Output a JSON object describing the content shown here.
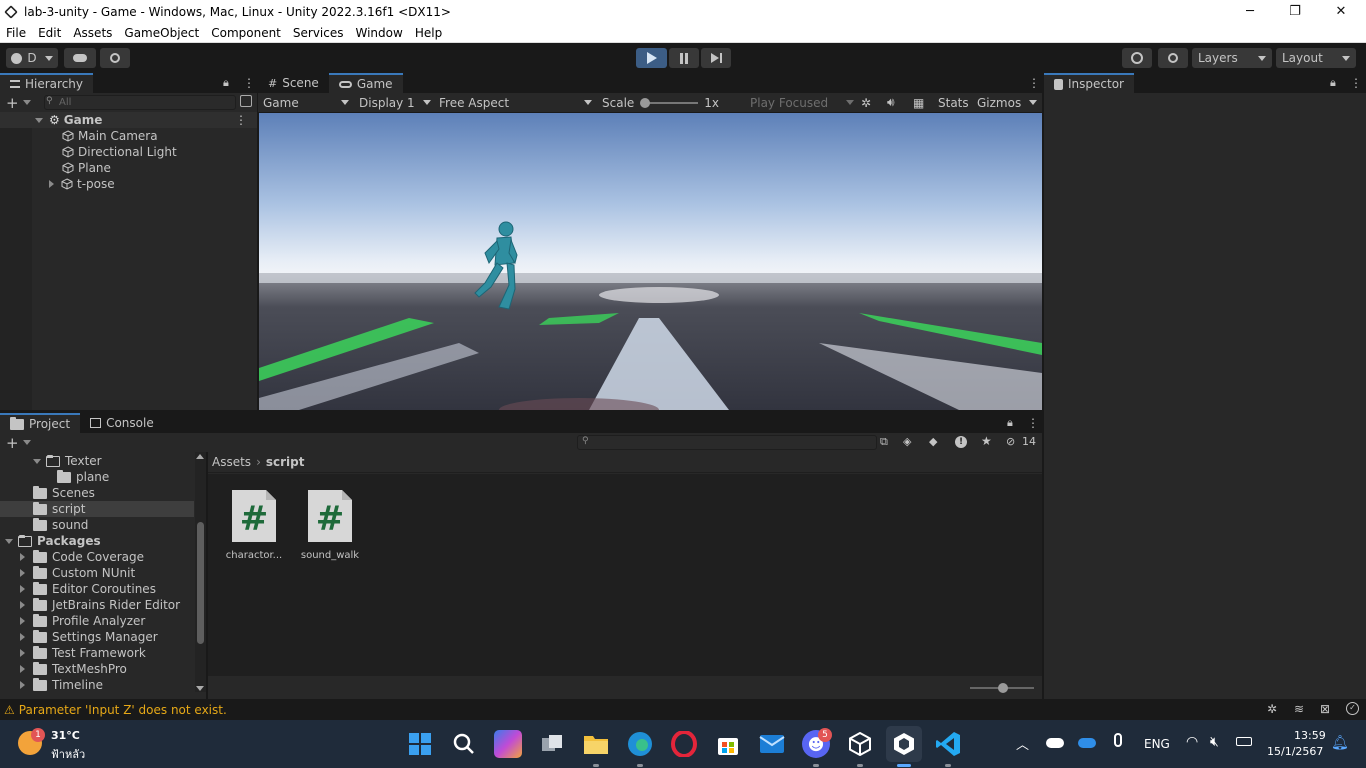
{
  "window": {
    "title": "lab-3-unity - Game - Windows, Mac, Linux - Unity 2022.3.16f1 <DX11>",
    "controls": {
      "minimize": "─",
      "maximize": "❐",
      "close": "✕"
    }
  },
  "menu": [
    "File",
    "Edit",
    "Assets",
    "GameObject",
    "Component",
    "Services",
    "Window",
    "Help"
  ],
  "toolbar": {
    "account_label": "D",
    "layers_label": "Layers",
    "layout_label": "Layout"
  },
  "hierarchy": {
    "tab_label": "Hierarchy",
    "search_placeholder": "All",
    "scene_name": "Game",
    "objects": [
      "Main Camera",
      "Directional Light",
      "Plane",
      "t-pose"
    ]
  },
  "game_view": {
    "tabs": [
      "Scene",
      "Game"
    ],
    "view_mode": "Game",
    "display": "Display 1",
    "aspect": "Free Aspect",
    "scale_label": "Scale",
    "scale_value": "1x",
    "play_mode": "Play Focused",
    "stats_label": "Stats",
    "gizmos_label": "Gizmos"
  },
  "inspector": {
    "tab_label": "Inspector"
  },
  "project": {
    "tabs": [
      "Project",
      "Console"
    ],
    "hidden_count": "14",
    "breadcrumb": [
      "Assets",
      "script"
    ],
    "tree": {
      "texter": "Texter",
      "plane": "plane",
      "scenes": "Scenes",
      "script": "script",
      "sound": "sound",
      "packages": "Packages",
      "package_items": [
        "Code Coverage",
        "Custom NUnit",
        "Editor Coroutines",
        "JetBrains Rider Editor",
        "Profile Analyzer",
        "Settings Manager",
        "Test Framework",
        "TextMeshPro",
        "Timeline"
      ]
    },
    "files": [
      "charactor...",
      "sound_walk"
    ]
  },
  "status": {
    "message": "Parameter 'Input Z' does not exist."
  },
  "taskbar": {
    "weather_temp": "31°C",
    "weather_desc": "ฟ้าหลัว",
    "weather_badge": "1",
    "discord_badge": "5",
    "language": "ENG",
    "time": "13:59",
    "date": "15/1/2567"
  },
  "colors": {
    "accent": "#3a79bb",
    "play_active": "#3c5d85",
    "warning": "#e6a817"
  }
}
